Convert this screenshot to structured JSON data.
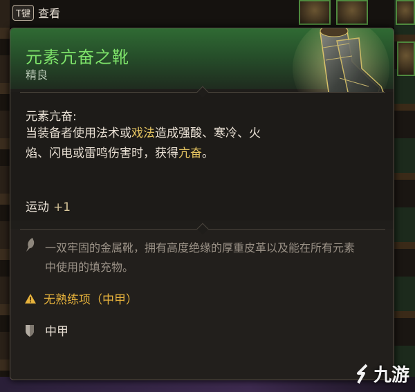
{
  "top_bar": {
    "key": "T键",
    "key_action": "查看"
  },
  "item": {
    "name": "元素亢奋之靴",
    "rarity": "精良",
    "passive_name": "元素亢奋:",
    "passive_desc_parts": [
      "当装备者使用法术或",
      "戏法",
      "造成强酸、寒冷、火焰、闪电或雷鸣伤害时，获得",
      "亢奋",
      "。"
    ],
    "stat_name": "运动",
    "stat_value": "+1",
    "flavor": "一双牢固的金属靴，拥有高度绝缘的厚重皮革以及能在所有元素中使用的填充物。",
    "warning": "无熟练项（中甲）",
    "armor_type": "中甲"
  },
  "icons": {
    "flavor": "quill-icon",
    "warning": "warning-triangle-icon",
    "armor": "shield-icon"
  },
  "colors": {
    "name": "#7ee36a",
    "header_green": "#2f6a33",
    "highlight": "#e7c662",
    "warning": "#e8b33c"
  },
  "watermark": {
    "text": "九游"
  }
}
